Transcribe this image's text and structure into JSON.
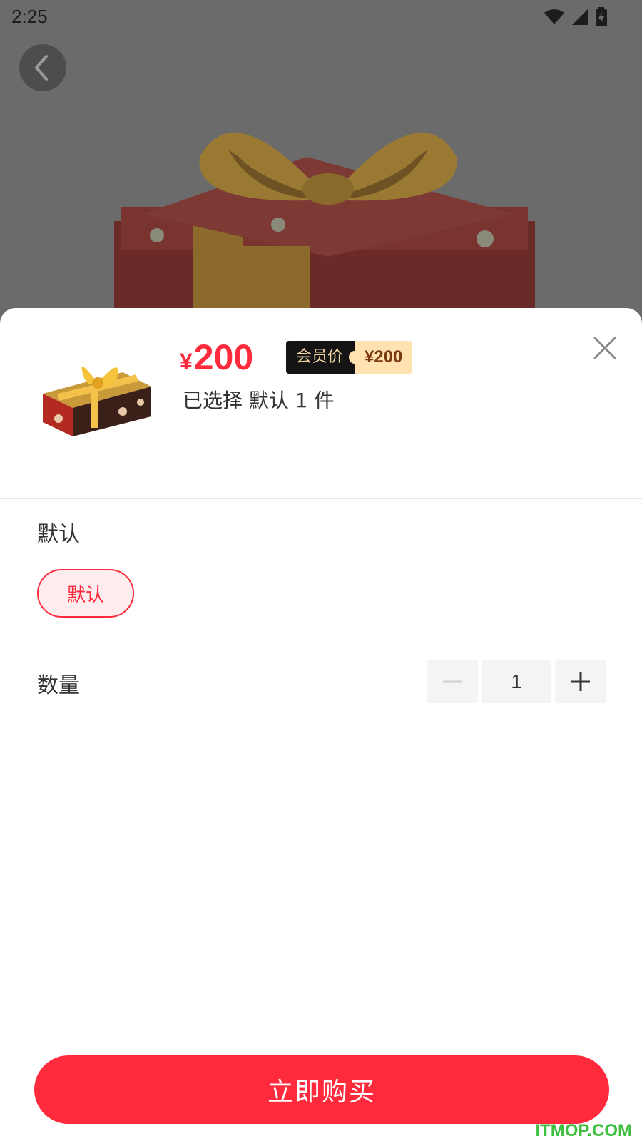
{
  "status_bar": {
    "time": "2:25",
    "icons": [
      "wifi-icon",
      "signal-icon",
      "battery-icon"
    ]
  },
  "background": {
    "back_icon": "chevron-left-icon",
    "hero_image": "gift-box-image"
  },
  "product": {
    "currency": "¥",
    "price": "200",
    "member_label": "会员价",
    "member_price": "¥200",
    "selected_text": "已选择 默认 1 件"
  },
  "spec": {
    "title": "默认",
    "options": [
      "默认"
    ],
    "selected": "默认"
  },
  "quantity": {
    "label": "数量",
    "value": "1",
    "decrement_icon": "minus-icon",
    "increment_icon": "plus-icon"
  },
  "actions": {
    "buy_label": "立即购买",
    "close_icon": "close-icon"
  },
  "watermark": "ITMOP.COM",
  "colors": {
    "accent": "#ff2b3d",
    "member_bg": "#141414",
    "member_price_bg": "#ffe2b0",
    "overlay": "#6b6b6b"
  }
}
